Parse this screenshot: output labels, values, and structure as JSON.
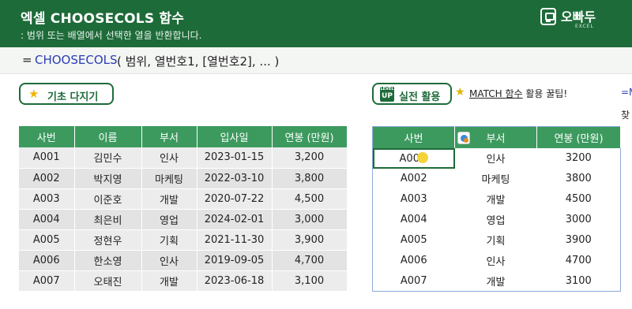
{
  "header": {
    "title": "엑셀 CHOOSECOLS 함수",
    "subtitle": ": 범위 또는 배열에서 선택한 열을 반환합니다.",
    "logo_text": "오빠두",
    "logo_sub": "EXCEL",
    "bg_color": "#1e6b3a"
  },
  "formula": {
    "eq": "=",
    "function": "CHOOSECOLS",
    "args": "( 범위, 열번호1, [열번호2], ... )"
  },
  "buttons": {
    "basic_label": "기초 다지기",
    "practical_badge_top": "LEVEL",
    "practical_badge_bottom": "UP",
    "practical_label": "실전 활용"
  },
  "tip": {
    "link": "MATCH 함수",
    "rest": " 활용 꿀팁!",
    "edge_top": "=M",
    "edge_bottom": "찾"
  },
  "table_source": {
    "headers": [
      "사번",
      "이름",
      "부서",
      "입사일",
      "연봉 (만원)"
    ],
    "rows": [
      [
        "A001",
        "김민수",
        "인사",
        "2023-01-15",
        "3,200"
      ],
      [
        "A002",
        "박지영",
        "마케팅",
        "2022-03-10",
        "3,800"
      ],
      [
        "A003",
        "이준호",
        "개발",
        "2020-07-22",
        "4,500"
      ],
      [
        "A004",
        "최은비",
        "영업",
        "2024-02-01",
        "3,000"
      ],
      [
        "A005",
        "정현우",
        "기획",
        "2021-11-30",
        "3,900"
      ],
      [
        "A006",
        "한소영",
        "인사",
        "2019-09-05",
        "4,700"
      ],
      [
        "A007",
        "오태진",
        "개발",
        "2023-06-18",
        "3,100"
      ]
    ]
  },
  "table_result": {
    "headers": [
      "사번",
      "부서",
      "연봉 (만원)"
    ],
    "rows": [
      [
        "A00",
        "인사",
        "3200"
      ],
      [
        "A002",
        "마케팅",
        "3800"
      ],
      [
        "A003",
        "개발",
        "4500"
      ],
      [
        "A004",
        "영업",
        "3000"
      ],
      [
        "A005",
        "기획",
        "3900"
      ],
      [
        "A006",
        "인사",
        "4700"
      ],
      [
        "A007",
        "개발",
        "3100"
      ]
    ]
  }
}
